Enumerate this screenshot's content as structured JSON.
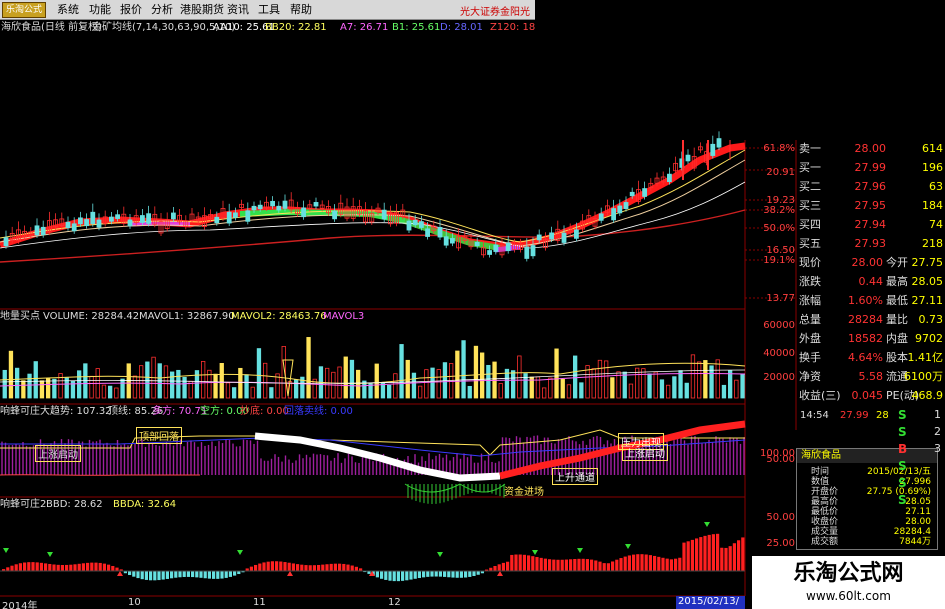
{
  "app": {
    "logo": "乐淘公式",
    "menu": [
      "系统",
      "功能",
      "报价",
      "分析",
      "港股期货",
      "资讯",
      "工具",
      "帮助"
    ],
    "broker": "光大证券金阳光"
  },
  "title": {
    "stock": "海欣食品(日线 前复权)",
    "indicator": "金矿均线(7,14,30,63,90,5,10)",
    "aa10": "AA10: 25.61",
    "bb20": "BB20: 22.81",
    "a7": "A7: 26.71",
    "b1": "B1: 25.61",
    "d": "D: 28.01",
    "z": "Z120: 18"
  },
  "price_axis": [
    "61.8%",
    "20.91",
    "19.23",
    "38.2%",
    "50.0%",
    "16.50",
    "19.1%",
    "13.77"
  ],
  "volume_panel": {
    "title": "地量买点",
    "volume": "VOLUME: 28284.42",
    "mavol1": "MAVOL1: 32867.90",
    "mavol2": "MAVOL2: 28463.76",
    "mavol3": "MAVOL3",
    "axis": [
      "60000",
      "40000",
      "20000"
    ]
  },
  "trend_panel": {
    "title": "响蜂可庄",
    "dqs": "大趋势: 107.32",
    "xs": "顶线: 85.26",
    "df": "多方: 70.71",
    "kf": "空方: 0.00",
    "sd": "抄底: 0.00",
    "last": "回落卖线:   0.00",
    "axis": [
      "100.00",
      "50.00"
    ],
    "labels": {
      "up_start": "上涨启动",
      "top_fall": "顶部回落",
      "capital": "资金进场",
      "rise": "上升通道",
      "strong_top": "压力出现",
      "strong_up": "上涨启动"
    }
  },
  "bbd_panel": {
    "title": "响蜂可庄2",
    "bbd": "BBD: 28.62",
    "bbda": "BBDA: 32.64",
    "axis": [
      "50.00",
      "25.00"
    ]
  },
  "dates": [
    "2014年",
    "10",
    "11",
    "12",
    "2015/02/13/五"
  ],
  "quote": {
    "rows": [
      {
        "l": "卖一",
        "v": "28.00",
        "v2": "614"
      },
      {
        "l": "买一",
        "v": "27.99",
        "v2": "196"
      },
      {
        "l": "买二",
        "v": "27.96",
        "v2": "63"
      },
      {
        "l": "买三",
        "v": "27.95",
        "v2": "184"
      },
      {
        "l": "买四",
        "v": "27.94",
        "v2": "74"
      },
      {
        "l": "买五",
        "v": "27.93",
        "v2": "218"
      },
      {
        "l": "现价",
        "v": "28.00",
        "l2": "今开",
        "v2": "27.75"
      },
      {
        "l": "涨跌",
        "v": "0.44",
        "l2": "最高",
        "v2": "28.05"
      },
      {
        "l": "涨幅",
        "v": "1.60%",
        "l2": "最低",
        "v2": "27.11"
      },
      {
        "l": "总量",
        "v": "28284",
        "l2": "量比",
        "v2": "0.73"
      },
      {
        "l": "外盘",
        "v": "18582",
        "l2": "内盘",
        "v2": "9702"
      },
      {
        "l": "换手",
        "v": "4.64%",
        "l2": "股本",
        "v2": "1.41亿"
      },
      {
        "l": "净资",
        "v": "5.58",
        "l2": "流通",
        "v2": "6100万"
      },
      {
        "l": "收益(三)",
        "v": "0.045",
        "l2": "PE(动)",
        "v2": "468.9"
      }
    ],
    "ticker": {
      "time": "14:54",
      "price": "27.99",
      "vol": "28"
    }
  },
  "popup": {
    "title": "海欣食品",
    "rows": [
      {
        "k": "时间",
        "v": "2015/02/13/五"
      },
      {
        "k": "数值",
        "v": "27.996"
      },
      {
        "k": "开盘价",
        "v": "27.75 (0.69%)"
      },
      {
        "k": "最高价",
        "v": "28.05"
      },
      {
        "k": "最低价",
        "v": "27.11"
      },
      {
        "k": "收盘价",
        "v": "28.00"
      },
      {
        "k": "成交量",
        "v": "28284.4"
      },
      {
        "k": "成交额",
        "v": "7844万"
      }
    ]
  },
  "bs": [
    "S",
    "S",
    "B",
    "S",
    "S",
    "S"
  ],
  "bs_nums": [
    "1",
    "2",
    "3"
  ],
  "watermark": {
    "cn": "乐淘公式网",
    "url": "www.60lt.com"
  },
  "colors": {
    "up": "#ff2a2a",
    "down": "#66e0e0",
    "ma_yellow": "#ffe35a",
    "ma_green": "#3fe24f",
    "grid": "#7a0000"
  }
}
